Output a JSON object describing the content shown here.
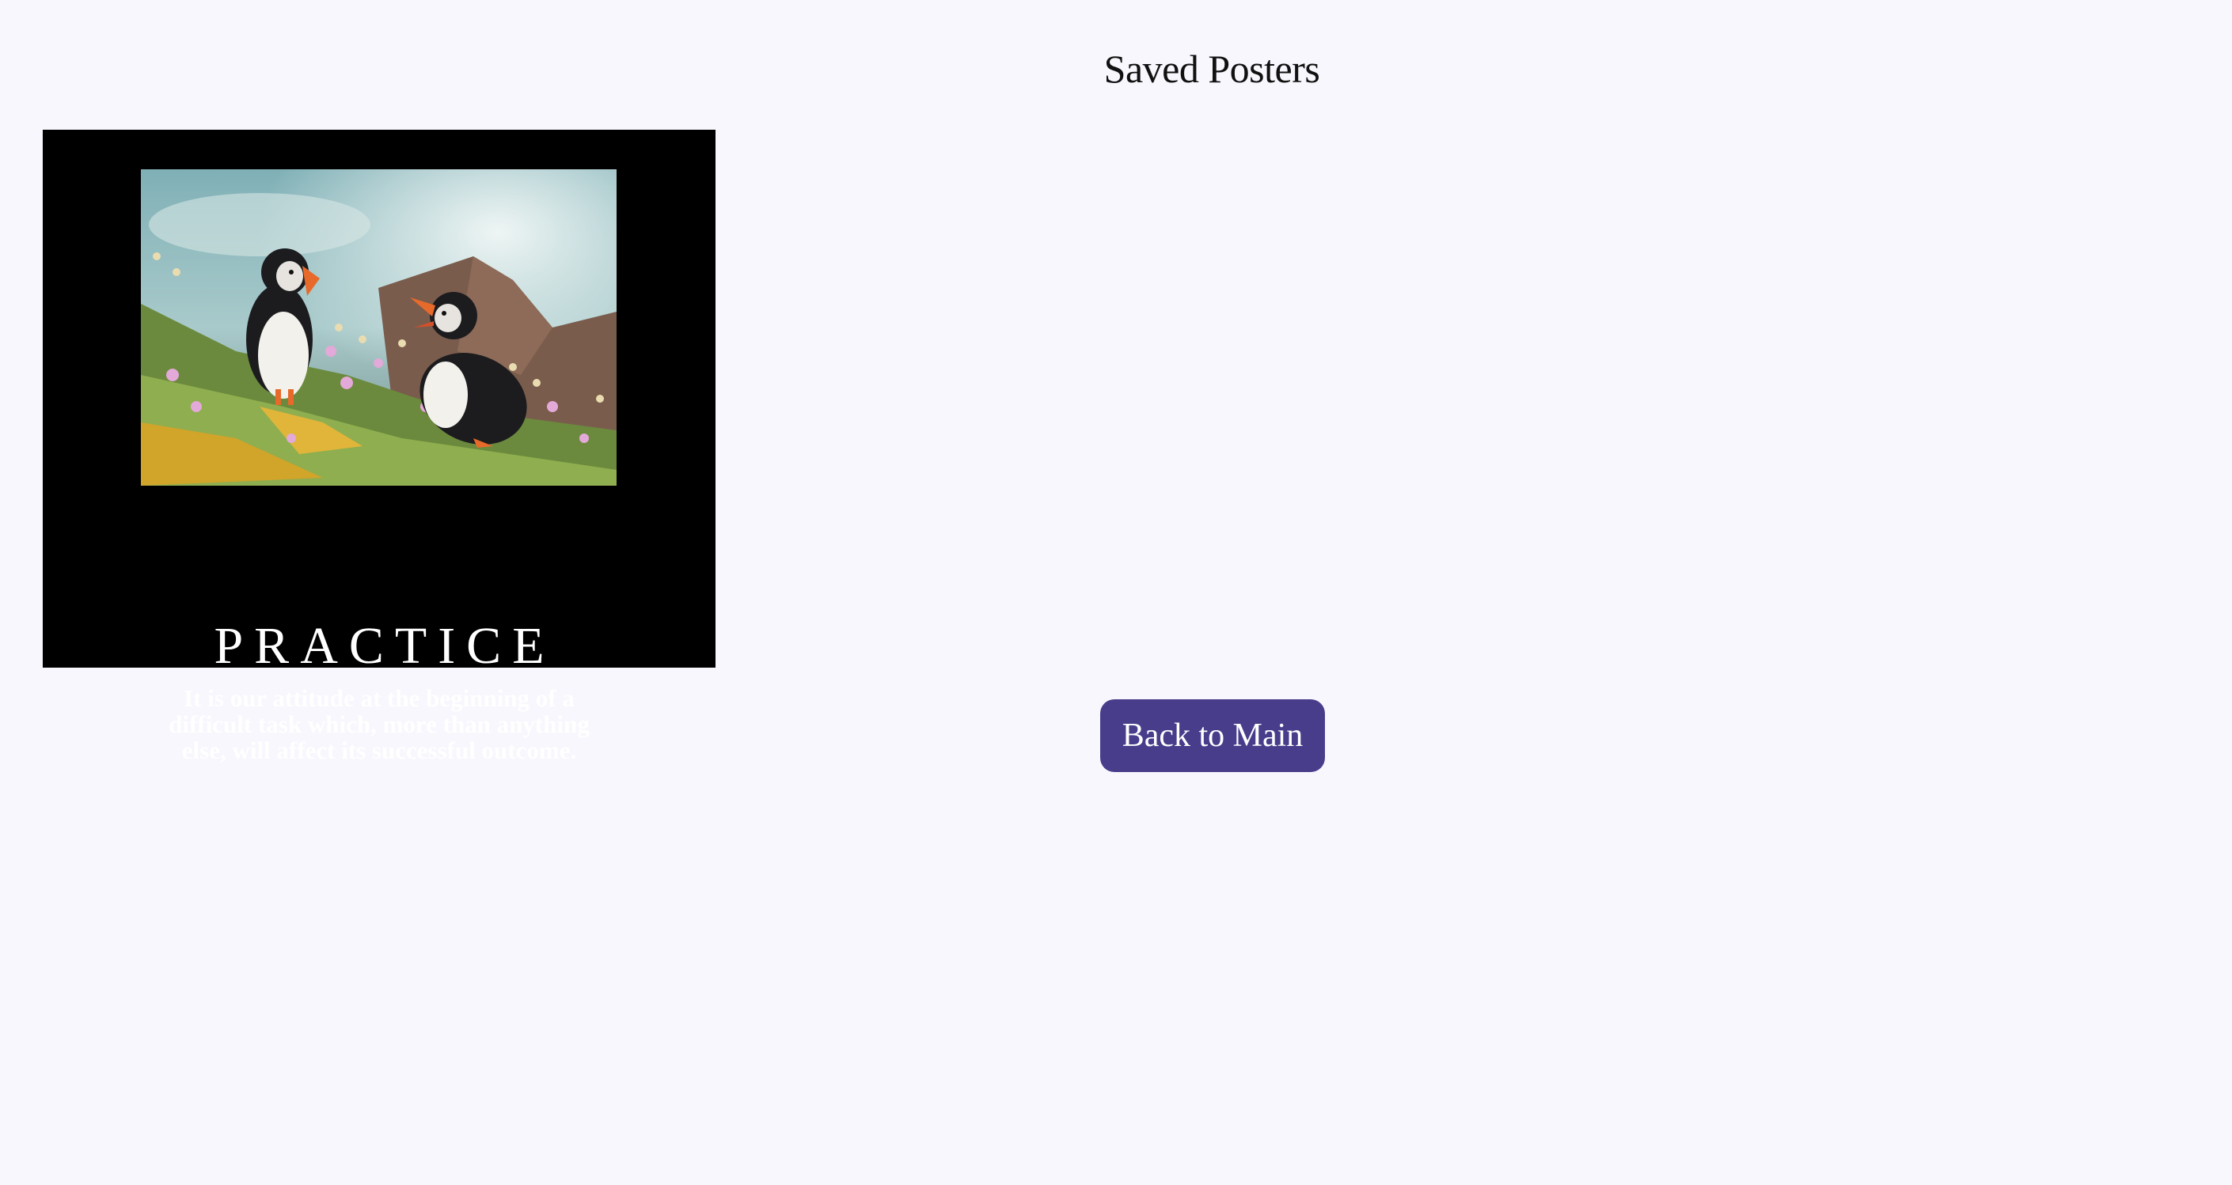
{
  "page": {
    "title": "Saved Posters",
    "background_color": "#f8f7fd"
  },
  "posters": [
    {
      "image_subject": "two puffins on a grassy cliff with pink flowers",
      "title": "PRACTICE",
      "quote": "It is our attitude at the beginning of a difficult task which, more than anything else, will affect its successful outcome."
    }
  ],
  "actions": {
    "back_label": "Back to Main",
    "button_color": "#483d8b"
  }
}
